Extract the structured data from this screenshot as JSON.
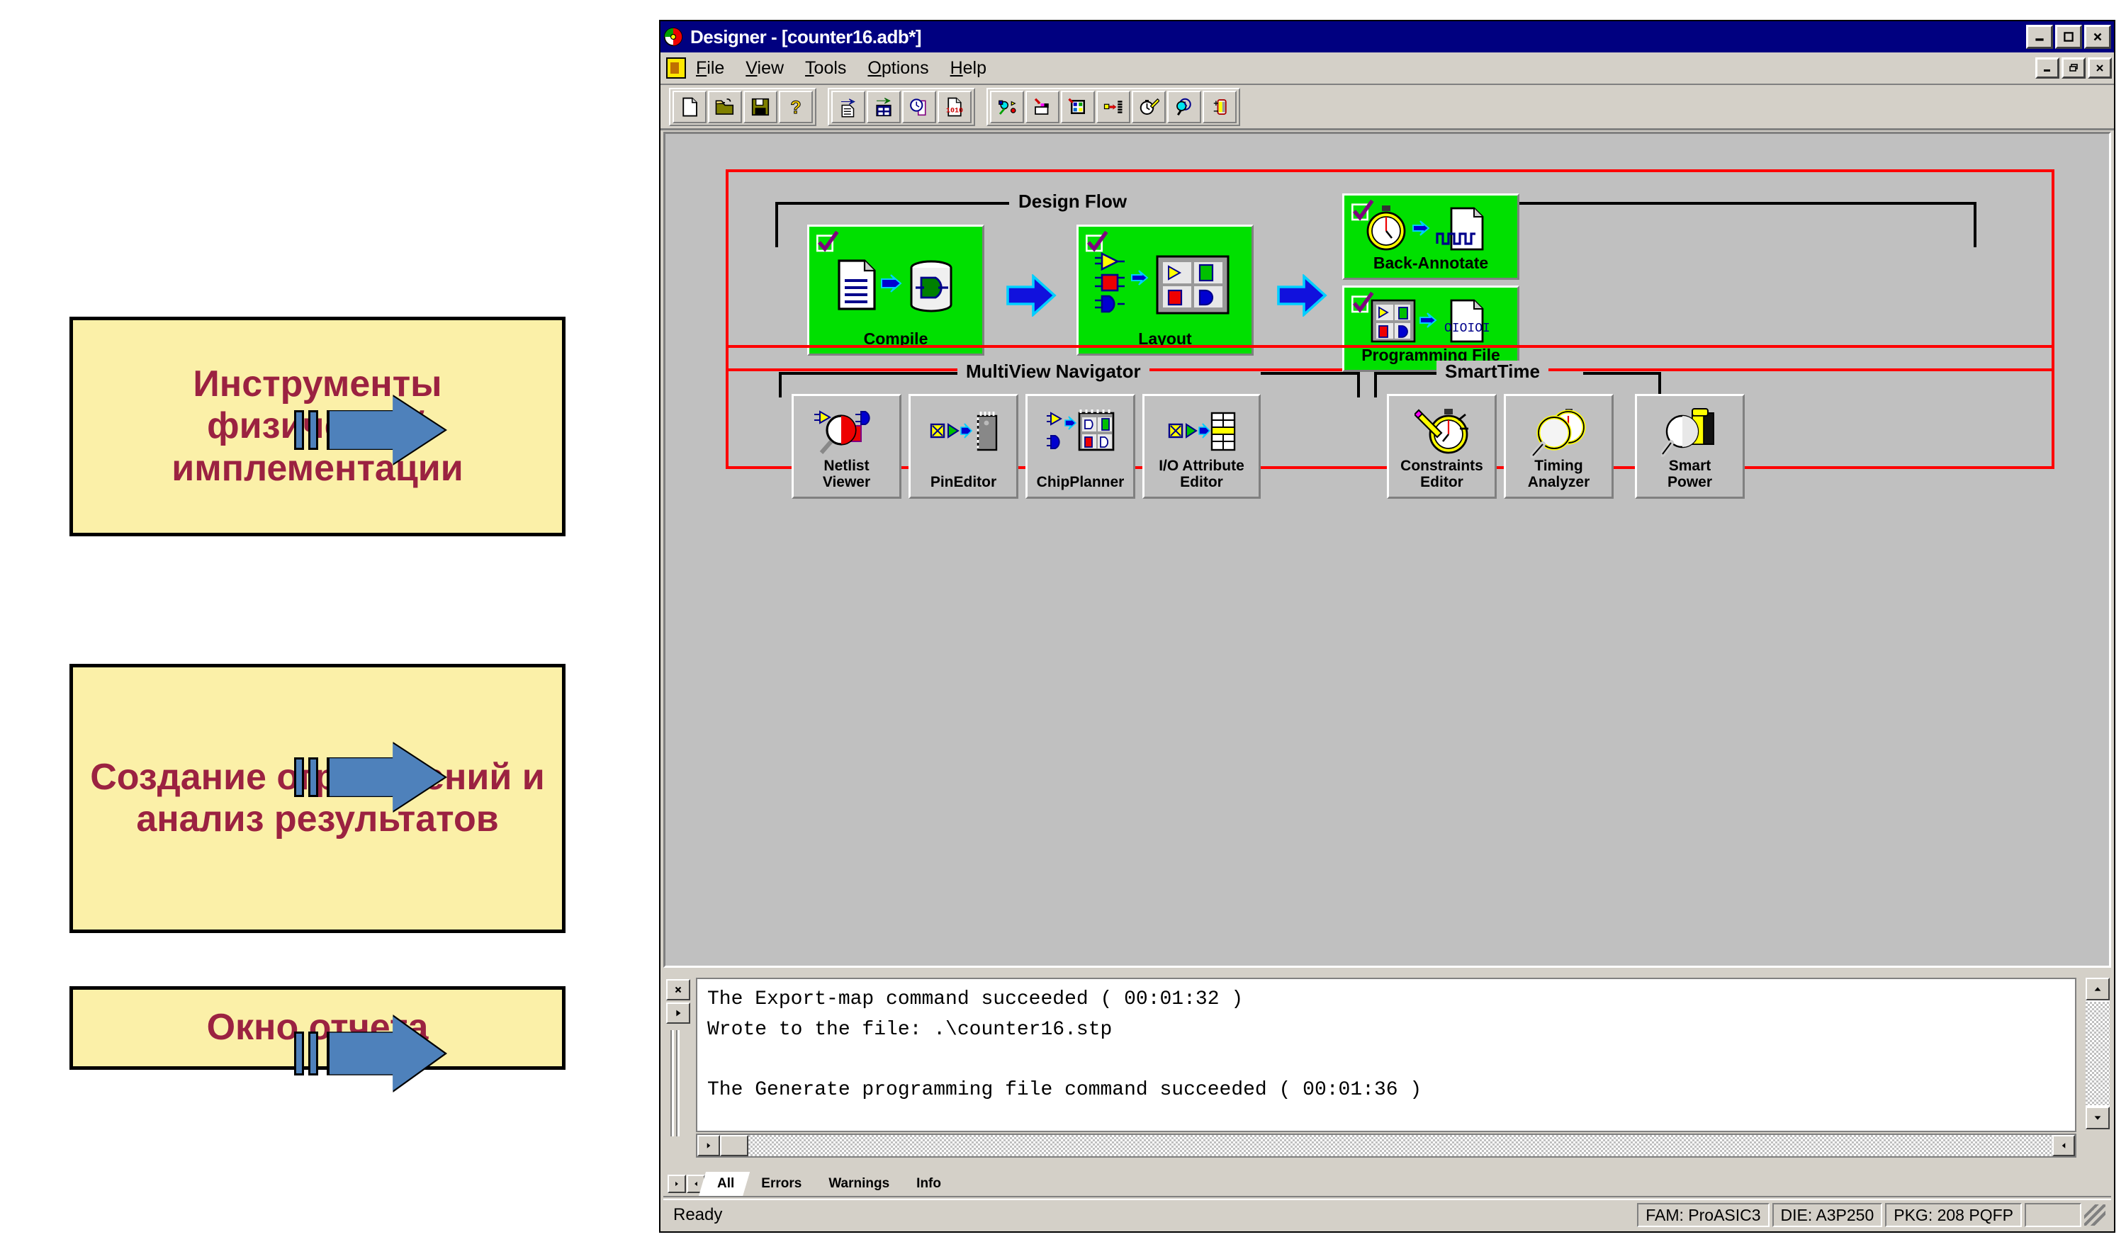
{
  "annotations": [
    {
      "id": "tools-physical-impl",
      "text": "Инструменты физической имплементации"
    },
    {
      "id": "constraints-analysis",
      "text": "Создание ограничений и анализ результатов"
    },
    {
      "id": "report-window",
      "text": "Окно отчета"
    }
  ],
  "window": {
    "title": "Designer - [counter16.adb*]",
    "app_icon": "designer-app-icon",
    "controls": {
      "minimize": "_",
      "maximize": "□",
      "close": "✕"
    },
    "mdi_controls": {
      "minimize": "_",
      "restore": "❐",
      "close": "✕"
    }
  },
  "menubar": {
    "items": [
      {
        "label": "File",
        "accel": "F"
      },
      {
        "label": "View",
        "accel": "V"
      },
      {
        "label": "Tools",
        "accel": "T"
      },
      {
        "label": "Options",
        "accel": "O"
      },
      {
        "label": "Help",
        "accel": "H"
      }
    ]
  },
  "toolbar": {
    "groups": [
      [
        "new-file-icon",
        "open-folder-icon",
        "save-disk-icon",
        "help-question-icon"
      ],
      [
        "import-netlist-icon",
        "import-constraints-icon",
        "timing-report-icon",
        "programming-file-icon"
      ],
      [
        "netlist-viewer-icon",
        "pin-editor-icon",
        "chip-planner-icon",
        "io-attribute-editor-icon",
        "constraints-editor-icon",
        "timing-analyzer-icon",
        "smart-power-icon"
      ]
    ]
  },
  "design_flow": {
    "group_label": "Design Flow",
    "tiles": [
      {
        "id": "compile",
        "label": "Compile",
        "checked": true,
        "icon": "document-to-database-icon"
      },
      {
        "id": "layout",
        "label": "Layout",
        "checked": true,
        "icon": "gates-to-chip-icon"
      },
      {
        "id": "back-annotate",
        "label": "Back-Annotate",
        "checked": true,
        "icon": "stopwatch-to-waveform-icon"
      },
      {
        "id": "programming-file",
        "label": "Programming File",
        "checked": true,
        "icon": "chip-to-binary-icon"
      }
    ]
  },
  "multiview_navigator": {
    "group_label": "MultiView Navigator",
    "buttons": [
      {
        "id": "netlist-viewer",
        "label": "Netlist\nViewer",
        "icon": "magnifier-gates-icon"
      },
      {
        "id": "pineditor",
        "label": "PinEditor",
        "icon": "pin-package-icon"
      },
      {
        "id": "chipplanner",
        "label": "ChipPlanner",
        "icon": "gates-chip-icon"
      },
      {
        "id": "io-attribute-editor",
        "label": "I/O Attribute\nEditor",
        "icon": "io-table-icon"
      }
    ]
  },
  "smarttime": {
    "group_label": "SmartTime",
    "buttons": [
      {
        "id": "constraints-editor",
        "label": "Constraints\nEditor",
        "icon": "stopwatch-pencil-icon"
      },
      {
        "id": "timing-analyzer",
        "label": "Timing\nAnalyzer",
        "icon": "magnifier-stopwatch-icon"
      },
      {
        "id": "smart-power",
        "label": "Smart\nPower",
        "icon": "magnifier-battery-icon"
      }
    ]
  },
  "log": {
    "lines": "The Export-map command succeeded ( 00:01:32 )\nWrote to the file: .\\counter16.stp\n\nThe Generate programming file command succeeded ( 00:01:36 )",
    "side_buttons": [
      "close-log-icon",
      "expand-log-icon"
    ],
    "scroll_up": "▲",
    "scroll_down": "▼",
    "scroll_left": "◀",
    "scroll_right": "▶"
  },
  "tabs": {
    "nav": [
      "◀",
      "▶"
    ],
    "items": [
      {
        "label": "All",
        "active": true
      },
      {
        "label": "Errors",
        "active": false
      },
      {
        "label": "Warnings",
        "active": false
      },
      {
        "label": "Info",
        "active": false
      }
    ]
  },
  "statusbar": {
    "message": "Ready",
    "cells": [
      "FAM: ProASIC3",
      "DIE: A3P250",
      "PKG: 208 PQFP",
      ""
    ]
  },
  "colors": {
    "titlebar": "#000080",
    "face": "#D4D0C8",
    "client": "#C0C0C0",
    "tile_green": "#00E000",
    "frame_red": "#FF0000",
    "callout_bg": "#FBF0A8",
    "callout_text": "#9B2241",
    "arrow_blue": "#4E81BB"
  }
}
